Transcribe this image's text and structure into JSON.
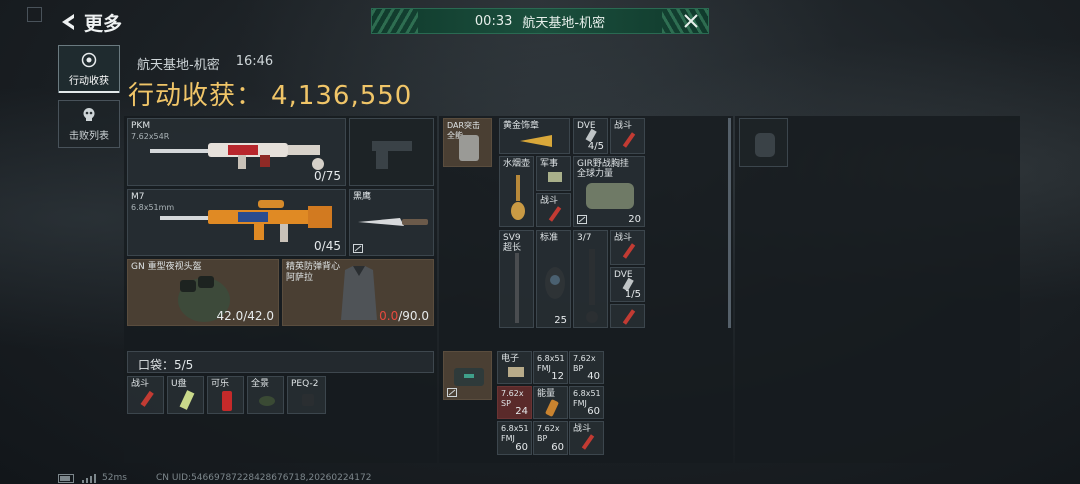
{
  "nav": {
    "back_label": "更多"
  },
  "banner": {
    "time": "00:33",
    "map": "航天基地-机密"
  },
  "side_tabs": [
    {
      "label": "行动收获",
      "icon": "target-icon",
      "active": true
    },
    {
      "label": "击败列表",
      "icon": "skull-icon",
      "active": false
    }
  ],
  "header": {
    "map_name": "航天基地-机密",
    "time": "16:46",
    "haul_label": "行动收获：",
    "haul_value": "4,136,550"
  },
  "gear": {
    "primary": {
      "name": "PKM",
      "caliber": "7.62x54R",
      "ammo": "0/75"
    },
    "secondary": {
      "name": "M7",
      "caliber": "6.8x51mm",
      "ammo": "0/45"
    },
    "melee": {
      "name": "黑鹰"
    },
    "helmet": {
      "name": "GN 重型夜视头盔",
      "durability": "42.0/42.0"
    },
    "armor": {
      "name_line1": "精英防弹背心",
      "name_line2": "阿萨拉",
      "durability_current": "0.0",
      "durability_max": "/90.0"
    }
  },
  "pocket": {
    "label": "口袋：5/5",
    "items": [
      {
        "label": "战斗"
      },
      {
        "label": "U盘"
      },
      {
        "label": "可乐"
      },
      {
        "label": "全景"
      },
      {
        "label": "PEQ-2"
      }
    ]
  },
  "containers": {
    "chest_label": "DAR突击\n全能",
    "chest_items": [
      {
        "label": "黄金饰章"
      },
      {
        "label": "DVE",
        "count": "4/5"
      },
      {
        "label": "战斗"
      },
      {
        "label": "水烟壶"
      },
      {
        "label": "军事"
      },
      {
        "label": "战斗"
      },
      {
        "label": "GIR野战胸挂\n全球力量",
        "count": "20"
      }
    ],
    "backpack_items": [
      {
        "label": "SV9\n超长"
      },
      {
        "label": "标准",
        "count": "25"
      },
      {
        "label": "3/7"
      },
      {
        "label": "战斗"
      },
      {
        "label": "DVE",
        "count": "1/5"
      }
    ],
    "case_items": [
      {
        "label": "电子"
      },
      {
        "label": "6.8x51\nFMJ",
        "count": "12"
      },
      {
        "label": "7.62x\nBP",
        "count": "40"
      },
      {
        "label": "7.62x\nSP",
        "count": "24"
      },
      {
        "label": "能量"
      },
      {
        "label": "6.8x51\nFMJ",
        "count": "60"
      },
      {
        "label": "6.8x51\nFMJ",
        "count": "60"
      },
      {
        "label": "7.62x\nBP",
        "count": "60"
      },
      {
        "label": "战斗"
      }
    ]
  },
  "status": {
    "ping": "52ms",
    "uid": "CN UID:54669787228428676718,20260224172"
  }
}
